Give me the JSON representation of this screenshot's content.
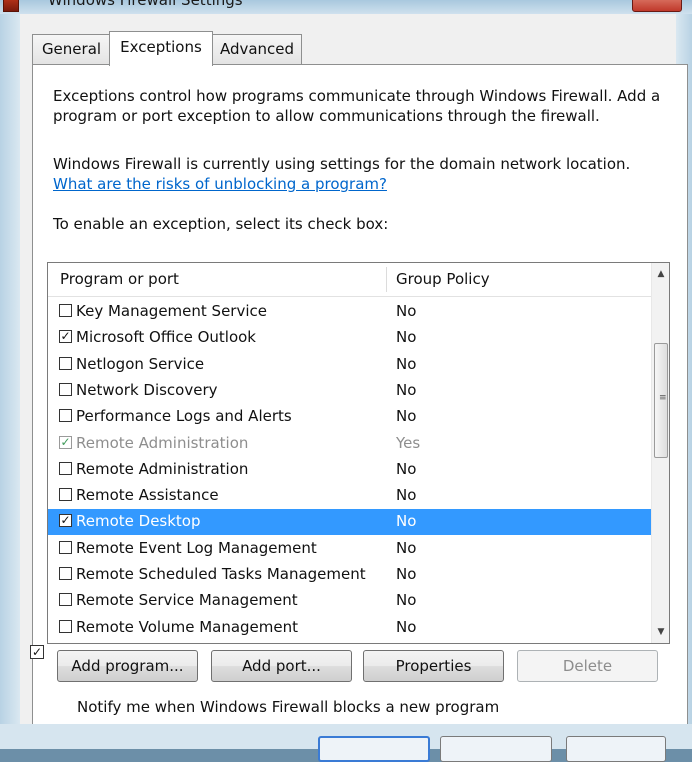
{
  "window": {
    "title": "Windows Firewall Settings"
  },
  "tabs": [
    {
      "label": "General"
    },
    {
      "label": "Exceptions",
      "active": true
    },
    {
      "label": "Advanced"
    }
  ],
  "exceptions": {
    "intro": [
      "Exceptions control how programs communicate through Windows Firewall. Add a",
      "program or port exception to allow communications through the firewall."
    ],
    "location_text": "Windows Firewall is currently using settings for the domain network location.",
    "risk_link": "What are the risks of unblocking a program?",
    "enable_prompt": "To enable an exception, select its check box:",
    "columns": [
      "Program or port",
      "Group Policy"
    ],
    "rows": [
      {
        "name": "Key Management Service",
        "policy": "No",
        "checked": false
      },
      {
        "name": "Microsoft Office Outlook",
        "policy": "No",
        "checked": true
      },
      {
        "name": "Netlogon Service",
        "policy": "No",
        "checked": false
      },
      {
        "name": "Network Discovery",
        "policy": "No",
        "checked": false
      },
      {
        "name": "Performance Logs and Alerts",
        "policy": "No",
        "checked": false
      },
      {
        "name": "Remote Administration",
        "policy": "Yes",
        "checked": true,
        "disabled": true
      },
      {
        "name": "Remote Administration",
        "policy": "No",
        "checked": false
      },
      {
        "name": "Remote Assistance",
        "policy": "No",
        "checked": false
      },
      {
        "name": "Remote Desktop",
        "policy": "No",
        "checked": true,
        "selected": true
      },
      {
        "name": "Remote Event Log Management",
        "policy": "No",
        "checked": false
      },
      {
        "name": "Remote Scheduled Tasks Management",
        "policy": "No",
        "checked": false
      },
      {
        "name": "Remote Service Management",
        "policy": "No",
        "checked": false
      },
      {
        "name": "Remote Volume Management",
        "policy": "No",
        "checked": false
      }
    ],
    "buttons": {
      "add_program": "Add program...",
      "add_port": "Add port...",
      "properties": "Properties",
      "delete": "Delete"
    },
    "notify_label": "Notify me when Windows Firewall blocks a new program",
    "notify_checked": true
  },
  "colors": {
    "selection": "#3399ff",
    "link": "#0066cc",
    "dialog_bg": "#f0f0f0"
  },
  "icons": {
    "title": "firewall-icon",
    "check": "check-mark-icon"
  }
}
